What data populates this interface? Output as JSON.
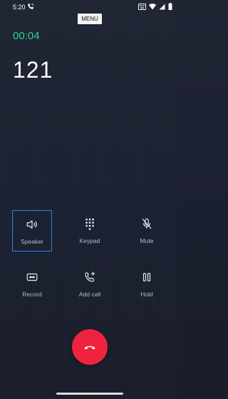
{
  "status_bar": {
    "time": "5:20",
    "icons": [
      "phone-call-icon",
      "keyboard-icon",
      "wifi-icon",
      "signal-icon",
      "battery-icon"
    ]
  },
  "menu": {
    "label": "MENU"
  },
  "call": {
    "duration": "00:04",
    "number": "121"
  },
  "controls": [
    {
      "label": "Speaker",
      "icon": "speaker-icon",
      "selected": true
    },
    {
      "label": "Keypad",
      "icon": "keypad-icon",
      "selected": false
    },
    {
      "label": "Mute",
      "icon": "mute-icon",
      "selected": false
    },
    {
      "label": "Record",
      "icon": "record-icon",
      "selected": false
    },
    {
      "label": "Add call",
      "icon": "add-call-icon",
      "selected": false
    },
    {
      "label": "Hold",
      "icon": "hold-icon",
      "selected": false
    }
  ],
  "colors": {
    "timer": "#2fd38c",
    "end_call": "#ef2340",
    "selection_border": "#2f87ea"
  }
}
